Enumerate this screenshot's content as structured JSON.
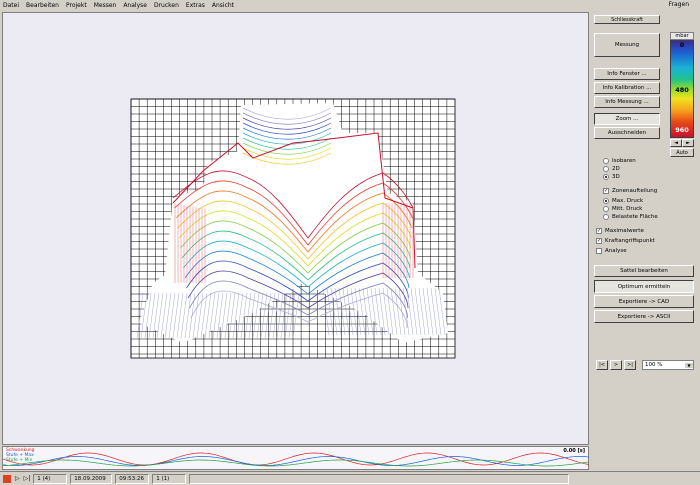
{
  "menu": [
    "Datei",
    "Bearbeiten",
    "Projekt",
    "Messen",
    "Analyse",
    "Drucken",
    "Extras",
    "Ansicht"
  ],
  "menu_right": "Fragen",
  "panel": {
    "title": "Schliesskraft",
    "measure_button": "Messung",
    "info_buttons": [
      "Info Fenster ...",
      "Info Kalibration ...",
      "Info Messung ..."
    ],
    "zoom_button": "Zoom ...",
    "cutout_button": "Ausschneiden",
    "view_options": [
      {
        "label": "Isobaren",
        "selected": false
      },
      {
        "label": "2D",
        "selected": false
      },
      {
        "label": "3D",
        "selected": true
      }
    ],
    "zone_check": {
      "label": "Zonenaufteilung",
      "checked": true
    },
    "pressure_options": [
      {
        "label": "Max. Druck",
        "selected": true
      },
      {
        "label": "Mitt. Druck",
        "selected": false
      },
      {
        "label": "Belastete Fläche",
        "selected": false
      }
    ],
    "checks": [
      {
        "label": "Maximalwerte",
        "checked": true
      },
      {
        "label": "Kraftangriffspunkt",
        "checked": true
      },
      {
        "label": "Analyse",
        "checked": false
      }
    ],
    "action_buttons": [
      "Sattel bearbeiten",
      "Optimum ermitteln",
      "Exportiere -> CAD",
      "Exportiere -> ASCII"
    ],
    "nav_buttons": [
      "|<",
      ">",
      ">|"
    ],
    "zoom_value": "100 %"
  },
  "scale": {
    "unit": "mbar",
    "labels": [
      "0",
      "480",
      "960"
    ],
    "auto_label": "Auto",
    "arrow_left": "◄",
    "arrow_right": "►"
  },
  "trace": {
    "legend": [
      "Schwankung",
      "Stufe + Max",
      "Stufe + Min"
    ],
    "time_label": "0.00 [s]",
    "colors": [
      "#e02020",
      "#2060e0",
      "#20a040"
    ]
  },
  "status": {
    "frame": "1 (4)",
    "date": "18.09.2009",
    "time": "09:53:26",
    "count": "1 (1)"
  },
  "colors": {
    "main_bg": "#ecebf4",
    "grid": "#000000"
  }
}
